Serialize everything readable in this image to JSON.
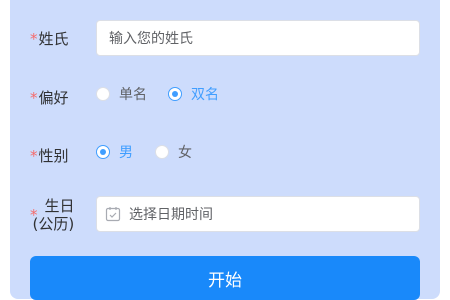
{
  "form": {
    "surname": {
      "required_mark": "*",
      "label": "姓氏",
      "placeholder": "输入您的姓氏"
    },
    "preference": {
      "required_mark": "*",
      "label": "偏好",
      "options": [
        {
          "label": "单名",
          "checked": false
        },
        {
          "label": "双名",
          "checked": true
        }
      ]
    },
    "gender": {
      "required_mark": "*",
      "label": "性别",
      "options": [
        {
          "label": "男",
          "checked": true
        },
        {
          "label": "女",
          "checked": false
        }
      ]
    },
    "birthday": {
      "required_mark": "*",
      "label_line1": "生日",
      "label_line2": "(公历)",
      "placeholder": "选择日期时间",
      "icon": "calendar-icon"
    },
    "submit_label": "开始"
  },
  "colors": {
    "panel_bg": "#cddcfc",
    "primary": "#1989fa",
    "radio_checked": "#409eff",
    "required": "#f56c6c"
  }
}
